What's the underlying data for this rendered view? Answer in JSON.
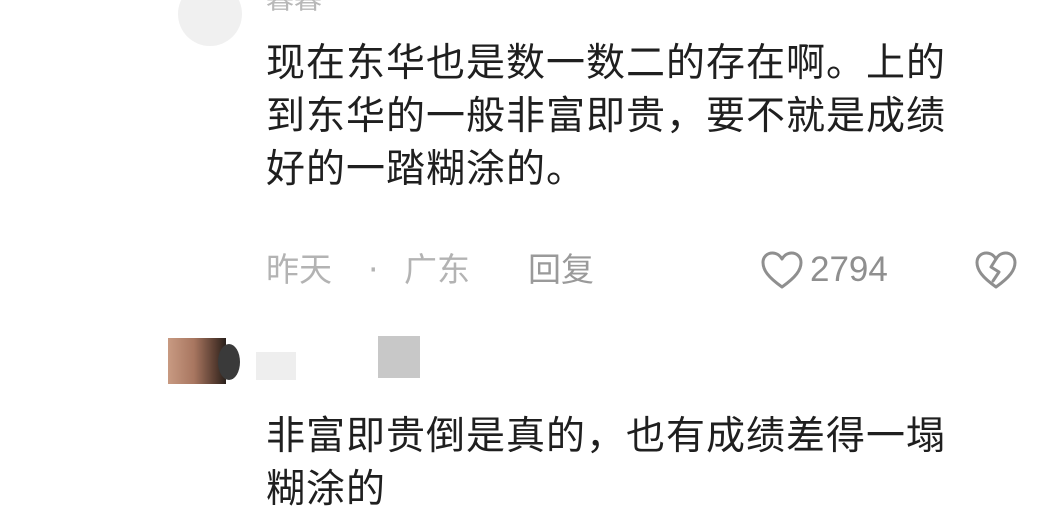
{
  "comments": [
    {
      "username": "暮暮",
      "text_line1": "现在东华也是数一数二的存在啊。上的",
      "text_line2": "到东华的一般非富即贵，要不就是成绩",
      "text_line3": "好的一踏糊涂的。",
      "time": "昨天",
      "separator": "·",
      "location": "广东",
      "reply_label": "回复",
      "like_count": "2794",
      "like_icon": "heart-outline-icon",
      "dislike_icon": "broken-heart-icon"
    },
    {
      "text_line1": "非富即贵倒是真的，也有成绩差得一塌",
      "text_line2": "糊涂的"
    }
  ],
  "colors": {
    "text": "#1f1f1f",
    "meta": "#b3b3b3",
    "icon": "#8f8f8f"
  }
}
